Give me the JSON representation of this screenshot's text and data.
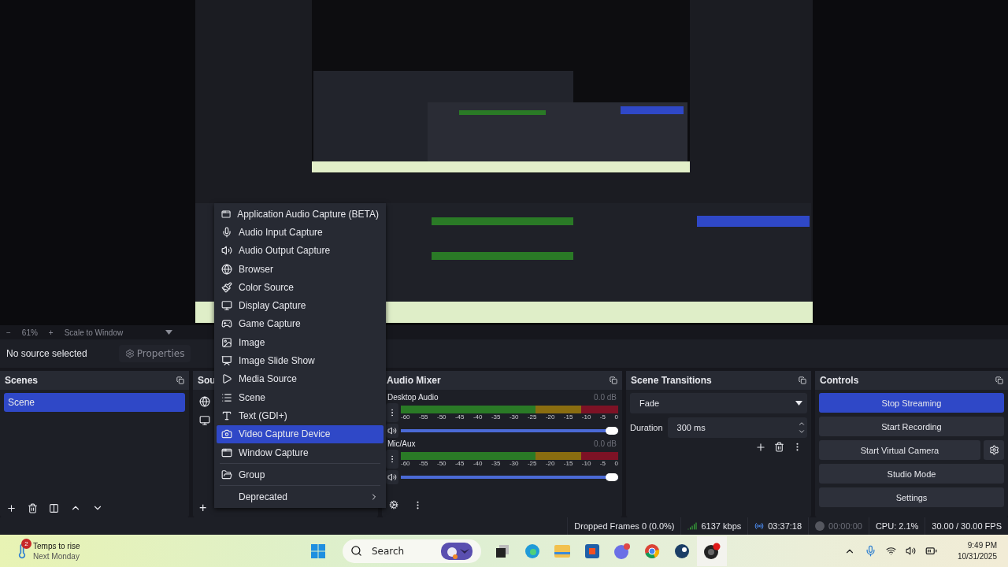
{
  "zoom_bar": {
    "minus": "−",
    "zoom": "61%",
    "plus": "+",
    "scale_mode": "Scale to Window"
  },
  "source_toolbar": {
    "status": "No source selected",
    "properties": "Properties"
  },
  "scenes": {
    "title": "Scenes",
    "items": [
      {
        "label": "Scene",
        "selected": true
      }
    ]
  },
  "sources": {
    "title": "Sou",
    "add": "+"
  },
  "audio_mixer": {
    "title": "Audio Mixer",
    "channels": [
      {
        "name": "Desktop Audio",
        "reading": "0.0 dB",
        "scale": [
          "-60",
          "-55",
          "-50",
          "-45",
          "-40",
          "-35",
          "-30",
          "-25",
          "-20",
          "-15",
          "-10",
          "-5",
          "0"
        ],
        "volume": {
          "level": 1
        }
      },
      {
        "name": "Mic/Aux",
        "reading": "0.0 dB",
        "scale": [
          "-60",
          "-55",
          "-50",
          "-45",
          "-40",
          "-35",
          "-30",
          "-25",
          "-20",
          "-15",
          "-10",
          "-5",
          "0"
        ],
        "volume": {
          "level": 1
        }
      }
    ]
  },
  "scene_transitions": {
    "title": "Scene Transitions",
    "transition": "Fade",
    "duration_label": "Duration",
    "duration": "300 ms"
  },
  "controls": {
    "title": "Controls",
    "buttons": [
      {
        "label": "Stop Streaming",
        "active": true
      },
      {
        "label": "Start Recording",
        "active": false
      },
      {
        "label": "Start Virtual Camera",
        "active": false
      },
      {
        "label": "Studio Mode",
        "active": false
      },
      {
        "label": "Settings",
        "active": false
      }
    ]
  },
  "context_menu": {
    "sections": [
      [
        {
          "label": "Application Audio Capture (BETA)",
          "selected": false,
          "submenu": false
        },
        {
          "label": "Audio Input Capture",
          "selected": false,
          "submenu": false
        },
        {
          "label": "Audio Output Capture",
          "selected": false,
          "submenu": false
        },
        {
          "label": "Browser",
          "selected": false,
          "submenu": false
        },
        {
          "label": "Color Source",
          "selected": false,
          "submenu": false
        },
        {
          "label": "Display Capture",
          "selected": false,
          "submenu": false
        },
        {
          "label": "Game Capture",
          "selected": false,
          "submenu": false
        },
        {
          "label": "Image",
          "selected": false,
          "submenu": false
        },
        {
          "label": "Image Slide Show",
          "selected": false,
          "submenu": false
        },
        {
          "label": "Media Source",
          "selected": false,
          "submenu": false
        },
        {
          "label": "Scene",
          "selected": false,
          "submenu": false
        },
        {
          "label": "Text (GDI+)",
          "selected": false,
          "submenu": false
        },
        {
          "label": "Video Capture Device",
          "selected": true,
          "submenu": false
        },
        {
          "label": "Window Capture",
          "selected": false,
          "submenu": false
        }
      ],
      [
        {
          "label": "Group",
          "selected": false,
          "submenu": false
        }
      ],
      [
        {
          "label": "Deprecated",
          "selected": false,
          "submenu": true
        }
      ]
    ]
  },
  "status_bar": {
    "dropped_frames": "Dropped Frames 0 (0.0%)",
    "bitrate": "6137 kbps",
    "stream_time": "03:37:18",
    "record_time": "00:00:00",
    "cpu": "CPU: 2.1%",
    "fps": "30.00 / 30.00 FPS"
  },
  "taskbar": {
    "weather": {
      "badge": "2",
      "headline": "Temps to rise",
      "subline": "Next Monday"
    },
    "search": {
      "placeholder": "Search"
    },
    "time": "9:49 PM",
    "date": "10/31/2025"
  }
}
